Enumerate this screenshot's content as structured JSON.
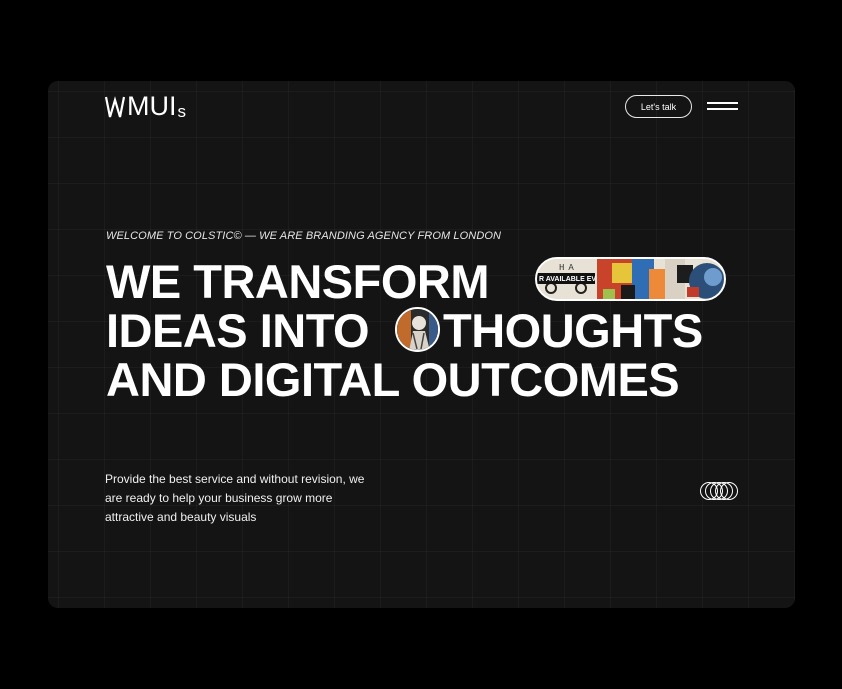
{
  "brand": {
    "logo_main": "MUI",
    "logo_suffix": "s"
  },
  "header": {
    "cta_label": "Let's talk",
    "menu_icon": "hamburger-icon"
  },
  "hero": {
    "eyebrow": "WELCOME TO COLSTIC© — WE ARE BRANDING AGENCY FROM LONDON",
    "line1": "WE TRANSFORM",
    "line2_a": "IDEAS INTO",
    "line2_b": "THOUGHTS",
    "line3": "AND DIGITAL OUTCOMES",
    "pill_image_caption": "R AVAILABLE EV",
    "pill_image_top_text": "HA"
  },
  "description": {
    "text": "Provide the best service and without revision, we are ready to help your business grow more attractive and beauty visuals"
  },
  "footer_icon": "overlapping-rings-icon",
  "colors": {
    "background": "#000000",
    "panel": "#141414",
    "text": "#ffffff"
  }
}
